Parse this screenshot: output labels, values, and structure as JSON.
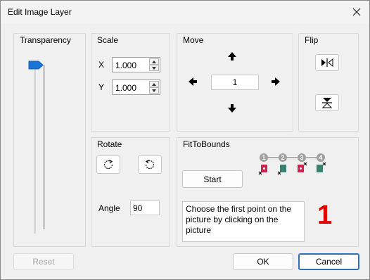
{
  "window": {
    "title": "Edit Image Layer"
  },
  "transparency": {
    "label": "Transparency"
  },
  "scale": {
    "label": "Scale",
    "x_label": "X",
    "x_value": "1.000",
    "y_label": "Y",
    "y_value": "1.000"
  },
  "move": {
    "label": "Move",
    "step_value": "1"
  },
  "flip": {
    "label": "Flip"
  },
  "rotate": {
    "label": "Rotate",
    "angle_label": "Angle",
    "angle_value": "90"
  },
  "fit": {
    "label": "FitToBounds",
    "start_label": "Start",
    "steps": [
      "1",
      "2",
      "3",
      "4"
    ],
    "instruction": "Choose the first point on the picture by clicking on the picture",
    "big_number": "1",
    "accent": "#e00000"
  },
  "footer": {
    "reset_label": "Reset",
    "ok_label": "OK",
    "cancel_label": "Cancel"
  }
}
